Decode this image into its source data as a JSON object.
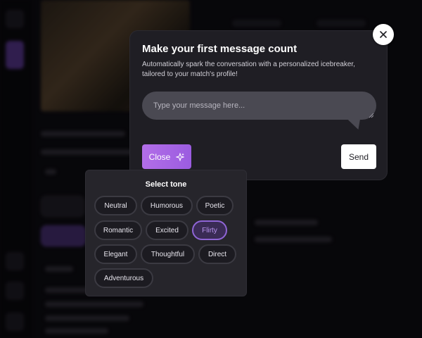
{
  "modal": {
    "title": "Make your first message count",
    "subtitle": "Automatically spark the conversation with a personalized icebreaker, tailored to your match's profile!",
    "input_placeholder": "Type your message here...",
    "input_value": "",
    "close_label": "Close",
    "send_label": "Send",
    "dismiss_icon": "close-x-icon",
    "sparkle_icon": "sparkle-icon"
  },
  "tone": {
    "title": "Select tone",
    "options": [
      "Neutral",
      "Humorous",
      "Poetic",
      "Romantic",
      "Excited",
      "Flirty",
      "Elegant",
      "Thoughtful",
      "Direct",
      "Adventurous"
    ],
    "selected": "Flirty"
  },
  "colors": {
    "accent": "#a463e6",
    "selected_chip_border": "#8f65d6",
    "modal_bg": "#1f1e24",
    "page_bg": "#0c0b10"
  }
}
